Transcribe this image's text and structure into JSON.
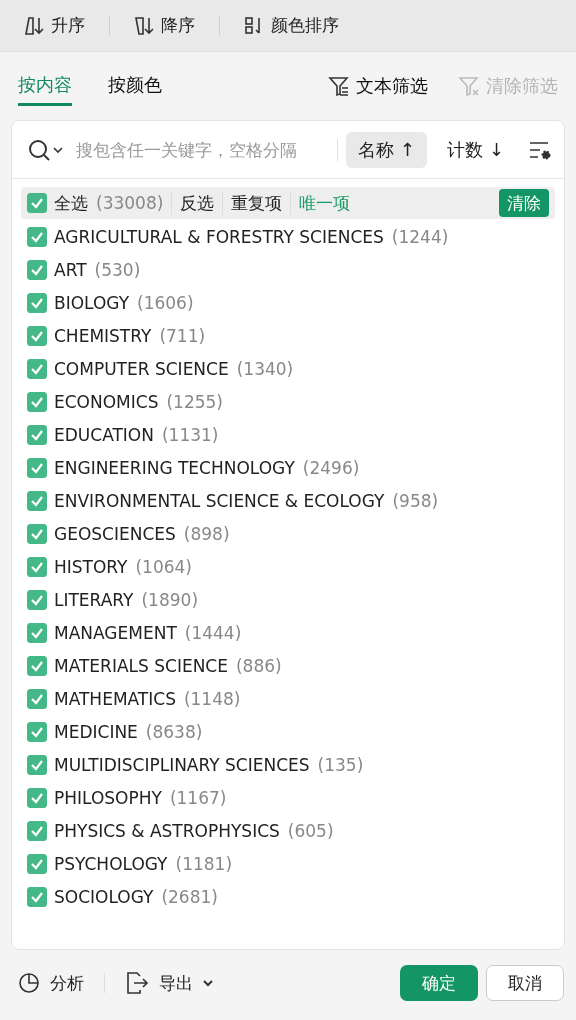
{
  "toolbar": [
    {
      "kind": "asc",
      "label": "升序"
    },
    {
      "kind": "desc",
      "label": "降序"
    },
    {
      "kind": "color",
      "label": "颜色排序"
    }
  ],
  "tabs": [
    {
      "label": "按内容",
      "selected": true
    },
    {
      "label": "按颜色",
      "selected": false
    }
  ],
  "filter_actions": [
    {
      "label": "文本筛选",
      "disabled": false
    },
    {
      "label": "清除筛选",
      "disabled": true
    }
  ],
  "search": {
    "placeholder": "搜包含任一关键字，空格分隔"
  },
  "sort_buttons": [
    {
      "label": "名称",
      "arrow": "↑",
      "selected": true
    },
    {
      "label": "计数",
      "arrow": "↓",
      "selected": false
    }
  ],
  "select_all": {
    "label": "全选",
    "count": "(33008)",
    "checked": true,
    "links": [
      {
        "label": "反选",
        "selected": false
      },
      {
        "label": "重复项",
        "selected": false
      },
      {
        "label": "唯一项",
        "selected": true
      }
    ],
    "clear": "清除"
  },
  "items": [
    {
      "name": "AGRICULTURAL & FORESTRY SCIENCES",
      "count": "(1244)",
      "checked": true
    },
    {
      "name": "ART",
      "count": "(530)",
      "checked": true
    },
    {
      "name": "BIOLOGY",
      "count": "(1606)",
      "checked": true
    },
    {
      "name": "CHEMISTRY",
      "count": "(711)",
      "checked": true
    },
    {
      "name": "COMPUTER SCIENCE",
      "count": "(1340)",
      "checked": true
    },
    {
      "name": "ECONOMICS",
      "count": "(1255)",
      "checked": true
    },
    {
      "name": "EDUCATION",
      "count": "(1131)",
      "checked": true
    },
    {
      "name": "ENGINEERING TECHNOLOGY",
      "count": "(2496)",
      "checked": true
    },
    {
      "name": "ENVIRONMENTAL SCIENCE & ECOLOGY",
      "count": "(958)",
      "checked": true
    },
    {
      "name": "GEOSCIENCES",
      "count": "(898)",
      "checked": true
    },
    {
      "name": "HISTORY",
      "count": "(1064)",
      "checked": true
    },
    {
      "name": "LITERARY",
      "count": "(1890)",
      "checked": true
    },
    {
      "name": "MANAGEMENT",
      "count": "(1444)",
      "checked": true
    },
    {
      "name": "MATERIALS SCIENCE",
      "count": "(886)",
      "checked": true
    },
    {
      "name": "MATHEMATICS",
      "count": "(1148)",
      "checked": true
    },
    {
      "name": "MEDICINE",
      "count": "(8638)",
      "checked": true
    },
    {
      "name": "MULTIDISCIPLINARY SCIENCES",
      "count": "(135)",
      "checked": true
    },
    {
      "name": "PHILOSOPHY",
      "count": "(1167)",
      "checked": true
    },
    {
      "name": "PHYSICS & ASTROPHYSICS",
      "count": "(605)",
      "checked": true
    },
    {
      "name": "PSYCHOLOGY",
      "count": "(1181)",
      "checked": true
    },
    {
      "name": "SOCIOLOGY",
      "count": "(2681)",
      "checked": true
    }
  ],
  "footer": {
    "analyze": "分析",
    "export": "导出",
    "ok": "确定",
    "cancel": "取消"
  }
}
